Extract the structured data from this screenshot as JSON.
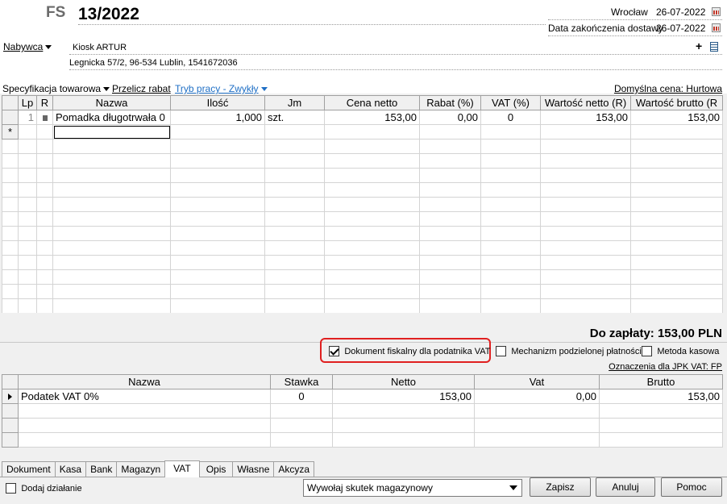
{
  "header": {
    "doc_type": "FS",
    "doc_number": "13/2022",
    "city": "Wrocław",
    "issue_date": "26-07-2022",
    "delivery_label": "Data zakończenia dostawy",
    "delivery_date": "26-07-2022"
  },
  "buyer": {
    "label": "Nabywca",
    "name": "Kiosk ARTUR",
    "address": "Legnicka  57/2, 96-534 Lublin, 1541672036",
    "add_symbol": "+"
  },
  "toolbar": {
    "spec": "Specyfikacja towarowa",
    "recalc": "Przelicz rabat",
    "mode": "Tryb pracy - Zwykły",
    "default_price": "Domyślna cena: Hurtowa"
  },
  "items_table": {
    "columns": [
      "Lp",
      "R",
      "Nazwa",
      "Ilość",
      "Jm",
      "Cena netto",
      "Rabat (%)",
      "VAT (%)",
      "Wartość netto (R)",
      "Wartość brutto (R"
    ],
    "rows": [
      {
        "lp": "1",
        "name": "Pomadka długotrwała 0",
        "qty": "1,000",
        "unit": "szt.",
        "price": "153,00",
        "discount": "0,00",
        "vat": "0",
        "net": "153,00",
        "gross": "153,00"
      }
    ],
    "new_row_marker": "*"
  },
  "summary": {
    "to_pay": "Do zapłaty: 153,00 PLN",
    "cb_fiscal": "Dokument fiskalny dla podatnika VAT",
    "cb_split": "Mechanizm podzielonej płatności",
    "cb_cash": "Metoda kasowa",
    "jpk": "Oznaczenia dla JPK VAT: FP"
  },
  "vat_table": {
    "columns": [
      "Nazwa",
      "Stawka",
      "Netto",
      "Vat",
      "Brutto"
    ],
    "rows": [
      {
        "name": "Podatek VAT 0%",
        "rate": "0",
        "net": "153,00",
        "vat": "0,00",
        "gross": "153,00"
      }
    ]
  },
  "tabs": [
    "Dokument",
    "Kasa",
    "Bank",
    "Magazyn",
    "VAT",
    "Opis",
    "Własne",
    "Akcyza"
  ],
  "footer": {
    "add_action": "Dodaj działanie",
    "select_value": "Wywołaj skutek magazynowy",
    "save": "Zapisz",
    "cancel": "Anuluj",
    "help": "Pomoc"
  }
}
